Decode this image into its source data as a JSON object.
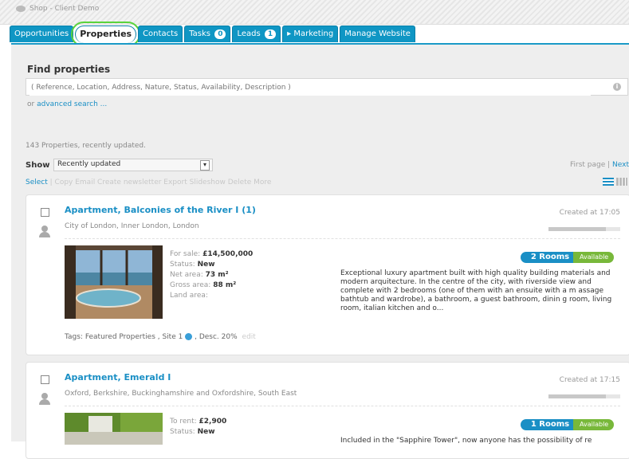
{
  "header": {
    "app_title": "Shop - Client Demo"
  },
  "tabs": [
    {
      "label": "Opportunities"
    },
    {
      "label": "Properties",
      "active": true
    },
    {
      "label": "Contacts"
    },
    {
      "label": "Tasks",
      "count": "0"
    },
    {
      "label": "Leads",
      "count": "1"
    },
    {
      "label": "▸ Marketing"
    },
    {
      "label": "Manage Website"
    }
  ],
  "find": {
    "title": "Find properties",
    "placeholder": "( Reference, Location, Address, Nature, Status, Availability, Description )",
    "advanced_prefix": "or",
    "advanced_link": "advanced search ..."
  },
  "list": {
    "count_text": "143 Properties, recently updated.",
    "show_label": "Show",
    "show_value": "Recently updated",
    "pager_prefix": "First page |",
    "pager_next": "Next",
    "select_label": "Select",
    "actions_text": "| Copy Email Create newsletter Export Slideshow Delete More"
  },
  "properties": [
    {
      "title": "Apartment, Balconies of the River I (1)",
      "location": "City of London, Inner London, London",
      "created": "Created at 17:05",
      "price_label": "For sale:",
      "price": "£14,500,000",
      "status_label": "Status:",
      "status": "New",
      "net_label": "Net area:",
      "net_area": "73 m²",
      "gross_label": "Gross area:",
      "gross_area": "88 m²",
      "land_label": "Land area:",
      "rooms": "2 Rooms",
      "availability": "Available",
      "description": "Exceptional luxury apartment built with high quality building materials and modern arquitecture. In the centre of the city, with riverside view and complete with 2 bedrooms (one of them with an ensuite with a m assage bathtub and wardrobe), a bathroom, a guest bathroom, dinin g room, living room, italian kitchen and o...",
      "tags": "Tags: Featured Properties , Site 1",
      "tags_tail": ", Desc. 20%",
      "edit": "edit"
    },
    {
      "title": "Apartment, Emerald I",
      "location": "Oxford, Berkshire, Buckinghamshire and Oxfordshire, South East",
      "created": "Created at 17:15",
      "price_label": "To rent:",
      "price": "£2,900",
      "status_label": "Status:",
      "status": "New",
      "rooms": "1 Rooms",
      "availability": "Available",
      "description": "Included in the \"Sapphire Tower\", now anyone has the possibility of re"
    }
  ],
  "colors": {
    "accent": "#1a8fc5",
    "tab_bg": "#0f96c4",
    "available": "#78b83a",
    "highlight_ring": "#5ad33c"
  }
}
